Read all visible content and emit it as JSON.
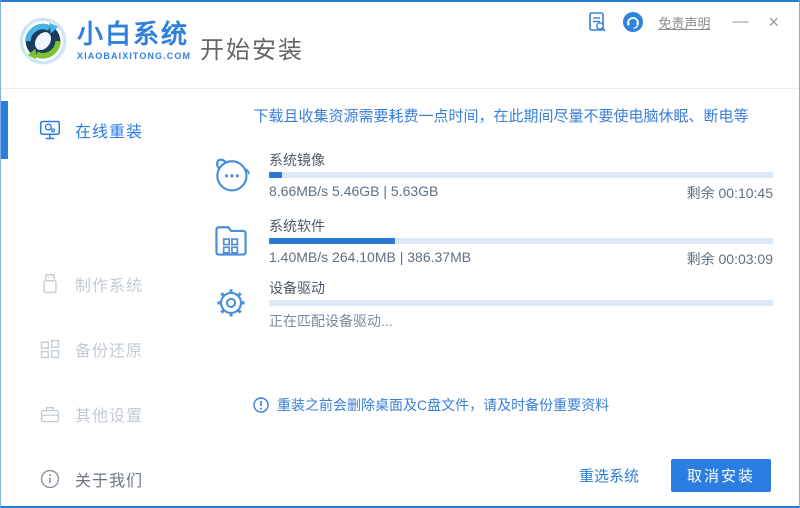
{
  "window": {
    "disclaimer_label": "免责声明",
    "minimize_label": "—",
    "close_label": "×"
  },
  "header": {
    "logo_title": "小白系统",
    "logo_subtitle": "XIAOBAIXITONG.COM",
    "page_title": "开始安装"
  },
  "sidebar": {
    "items": [
      {
        "label": "在线重装",
        "state": "active",
        "icon": "monitor-icon"
      },
      {
        "label": "制作系统",
        "state": "disabled",
        "icon": "usb-icon"
      },
      {
        "label": "备份还原",
        "state": "disabled",
        "icon": "blocks-icon"
      },
      {
        "label": "其他设置",
        "state": "disabled",
        "icon": "briefcase-icon"
      },
      {
        "label": "关于我们",
        "state": "normal",
        "icon": "info-icon"
      }
    ]
  },
  "main": {
    "warning": "下载且收集资源需要耗费一点时间，在此期间尽量不要使电脑休眠、断电等",
    "tasks": [
      {
        "name": "系统镜像",
        "icon": "face-icon",
        "progress_percent": 2.5,
        "stats": "8.66MB/s 5.46GB | 5.63GB",
        "remaining": "剩余 00:10:45"
      },
      {
        "name": "系统软件",
        "icon": "folder-icon",
        "progress_percent": 25,
        "stats": "1.40MB/s 264.10MB | 386.37MB",
        "remaining": "剩余 00:03:09"
      },
      {
        "name": "设备驱动",
        "icon": "gear-icon",
        "progress_percent": 0,
        "stats": "正在匹配设备驱动...",
        "remaining": ""
      }
    ],
    "notice": "重装之前会删除桌面及C盘文件，请及时备份重要资料"
  },
  "footer": {
    "reselect_label": "重选系统",
    "cancel_label": "取消安装"
  },
  "colors": {
    "accent_blue": "#2b7de1",
    "progress_fill": "#2878d4",
    "progress_track": "#dde9f7",
    "warning_text": "#3a7ed8",
    "disabled_gray": "#c4cbd4"
  }
}
